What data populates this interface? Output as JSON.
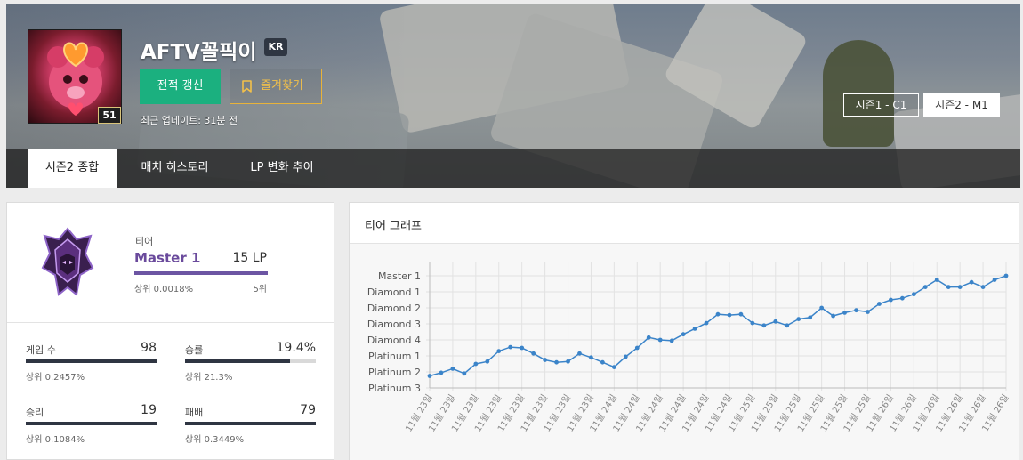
{
  "header": {
    "summoner_name": "AFTV꼴픽이",
    "region": "KR",
    "level": "51",
    "refresh_label": "전적 갱신",
    "favorite_label": "즐겨찾기",
    "last_updated": "최근 업데이트: 31분 전",
    "season_tags": [
      "시즌1 - C1",
      "시즌2 - M1"
    ],
    "tabs": [
      "시즌2 종합",
      "매치 히스토리",
      "LP 변화 추이"
    ],
    "accent_colors": {
      "refresh": "#1bb07f",
      "favorite": "#e8b33a"
    }
  },
  "tier": {
    "label": "티어",
    "name": "Master 1",
    "lp": "15 LP",
    "top_percent": "상위 0.0018%",
    "rank": "5위",
    "emblem_icon": "master-emblem-icon",
    "color": "#6a4a9c"
  },
  "stats": [
    {
      "label": "게임 수",
      "value": "98",
      "sub": "상위 0.2457%",
      "bar_fraction": 1.0
    },
    {
      "label": "승률",
      "value": "19.4%",
      "sub": "상위 21.3%",
      "bar_fraction": 0.8
    },
    {
      "label": "승리",
      "value": "19",
      "sub": "상위 0.1084%",
      "bar_fraction": 1.0
    },
    {
      "label": "패배",
      "value": "79",
      "sub": "상위 0.3449%",
      "bar_fraction": 1.0
    }
  ],
  "chart_panel": {
    "title": "티어 그래프"
  },
  "chart_data": {
    "type": "line",
    "y_tick_labels": [
      "Platinum 3",
      "Platinum 2",
      "Platinum 1",
      "Diamond 4",
      "Diamond 3",
      "Diamond 2",
      "Diamond 1",
      "Master 1"
    ],
    "x_tick_labels": [
      "11월 23일",
      "11월 23일",
      "11월 23일",
      "11월 23일",
      "11월 23일",
      "11월 23일",
      "11월 23일",
      "11월 23일",
      "11월 24일",
      "11월 24일",
      "11월 24일",
      "11월 24일",
      "11월 24일",
      "11월 24일",
      "11월 25일",
      "11월 25일",
      "11월 25일",
      "11월 25일",
      "11월 25일",
      "11월 25일",
      "11월 26일",
      "11월 26일",
      "11월 26일",
      "11월 26일",
      "11월 26일",
      "11월 26일"
    ],
    "values": [
      0.75,
      0.95,
      1.2,
      0.9,
      1.5,
      1.65,
      2.3,
      2.55,
      2.5,
      2.15,
      1.75,
      1.6,
      1.65,
      2.15,
      1.9,
      1.6,
      1.3,
      1.95,
      2.5,
      3.15,
      3.0,
      2.95,
      3.35,
      3.7,
      4.05,
      4.6,
      4.55,
      4.6,
      4.05,
      3.9,
      4.15,
      3.9,
      4.3,
      4.4,
      5.0,
      4.5,
      4.7,
      4.85,
      4.75,
      5.25,
      5.5,
      5.6,
      5.85,
      6.3,
      6.75,
      6.3,
      6.3,
      6.6,
      6.3,
      6.75,
      7.0
    ],
    "ylim": [
      0,
      7
    ],
    "grid": true,
    "color": "#3b84c9"
  }
}
